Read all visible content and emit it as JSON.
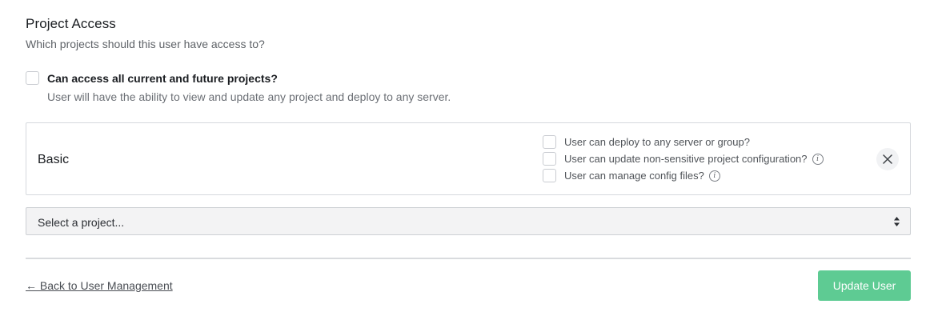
{
  "section": {
    "title": "Project Access",
    "subtitle": "Which projects should this user have access to?"
  },
  "all_projects": {
    "label": "Can access all current and future projects?",
    "help": "User will have the ability to view and update any project and deploy to any server.",
    "checked": false
  },
  "project": {
    "name": "Basic",
    "permissions": [
      {
        "label": "User can deploy to any server or group?",
        "info": false
      },
      {
        "label": "User can update non-sensitive project configuration?",
        "info": true
      },
      {
        "label": "User can manage config files?",
        "info": true
      }
    ],
    "remove_icon": "close-icon"
  },
  "project_select": {
    "value": "Select a project..."
  },
  "footer": {
    "back_label": "← Back to User Management",
    "submit_label": "Update User",
    "submit_color": "#5ecb93"
  }
}
